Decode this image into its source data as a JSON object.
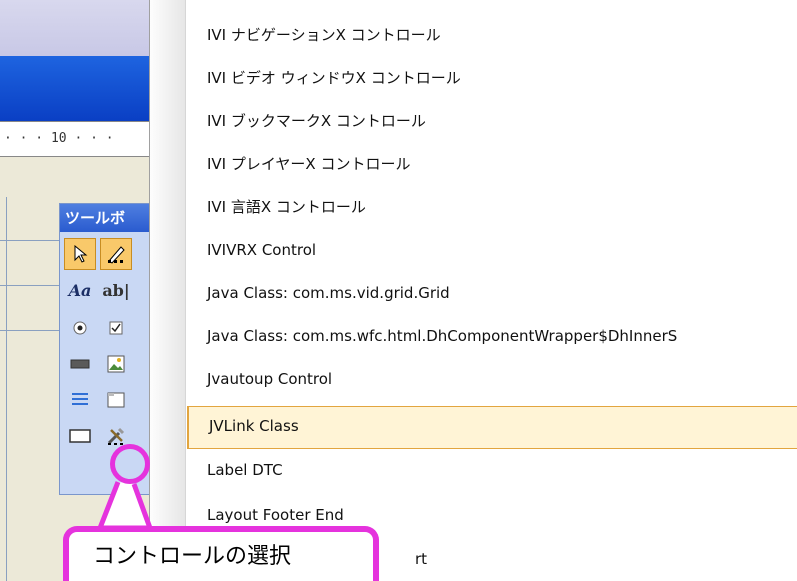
{
  "ruler": {
    "text": "· · · 10 · · ·"
  },
  "toolbox": {
    "title": "ツールボ",
    "tools": [
      "pointer",
      "multi-select",
      "label",
      "textbox",
      "radio",
      "checkbox",
      "button",
      "image",
      "list",
      "frame",
      "rectangle",
      "more-controls"
    ],
    "text_label_glyph": "Aa",
    "textbox_glyph": "ab|"
  },
  "menu": {
    "items": [
      {
        "label": "IVI ナビゲーションX コントロール"
      },
      {
        "label": "IVI ビデオ ウィンドウX コントロール"
      },
      {
        "label": "IVI ブックマークX コントロール"
      },
      {
        "label": "IVI プレイヤーX コントロール"
      },
      {
        "label": "IVI 言語X コントロール"
      },
      {
        "label": "IVIVRX Control"
      },
      {
        "label": "Java Class: com.ms.vid.grid.Grid"
      },
      {
        "label": "Java Class: com.ms.wfc.html.DhComponentWrapper$DhInnerS"
      },
      {
        "label": "Jvautoup Control"
      },
      {
        "label": "JVLink Class",
        "highlighted": true
      },
      {
        "label": "Label DTC"
      },
      {
        "label": "Layout Footer End"
      },
      {
        "label": "rt"
      }
    ]
  },
  "callout": {
    "text": "コントロールの選択",
    "color": "#e533dd"
  },
  "colors": {
    "highlight_bg": "#fff4d6",
    "highlight_border": "#e2a53f",
    "toolbox_title": "#2a5bcf"
  }
}
